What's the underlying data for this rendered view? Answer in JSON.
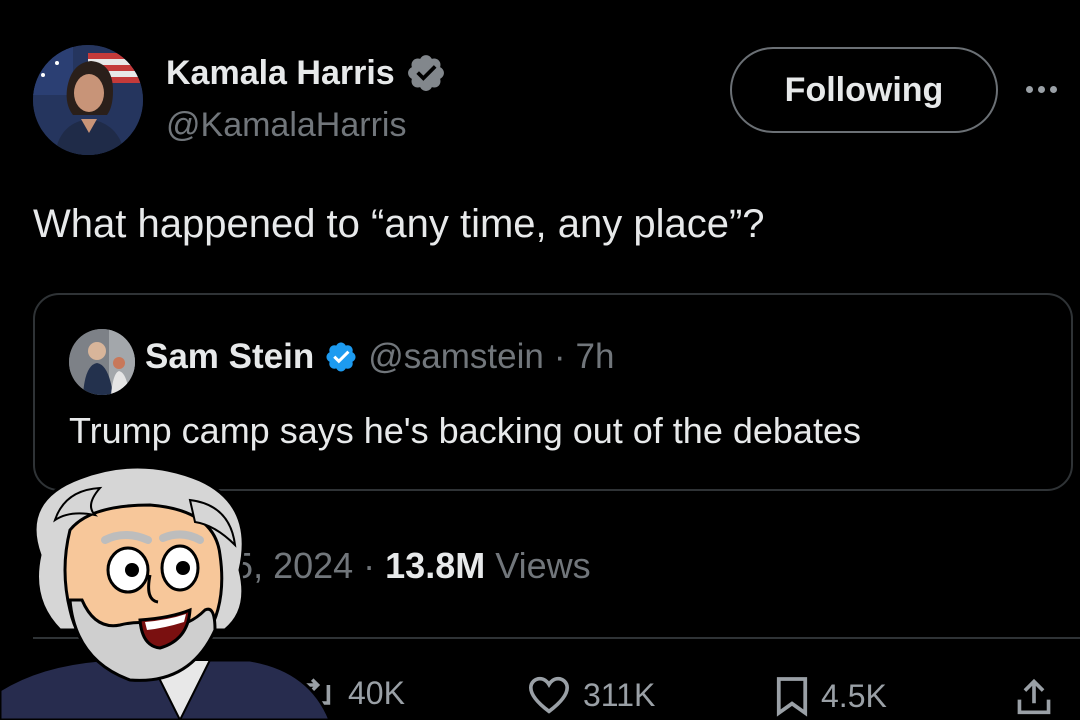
{
  "tweet": {
    "author": {
      "name": "Kamala Harris",
      "handle": "@KamalaHarris",
      "verified_badge": "gray-checkmark-badge-icon"
    },
    "follow_button_label": "Following",
    "more_icon": "ellipsis-icon",
    "text": "What happened to “any time, any place”?",
    "quote": {
      "author_name": "Sam Stein",
      "verified_badge": "blue-checkmark-badge-icon",
      "handle": "@samstein",
      "separator": "·",
      "time": "7h",
      "text": "Trump camp says he's backing out of the debates"
    },
    "meta": {
      "date_visible": "ul 25, 2024",
      "separator": "·",
      "views_count": "13.8M",
      "views_label": "Views"
    },
    "actions": {
      "retweets": "40K",
      "likes": "311K",
      "bookmarks": "4.5K"
    }
  },
  "colors": {
    "background": "#000000",
    "primary_text": "#e7e9ea",
    "secondary_text": "#71767b",
    "verified_blue": "#1d9bf0",
    "border": "#2f3336"
  },
  "overlay": {
    "description_icon": "cartoon-old-man-overlay"
  }
}
